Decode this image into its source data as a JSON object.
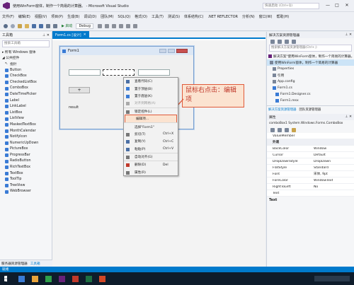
{
  "window": {
    "title": "使用WinForm窗体，制作一个简易的计算器。 - Microsoft Visual Studio",
    "quick_launch": "快速启动 (Ctrl+Q)"
  },
  "menu": [
    "文件(F)",
    "编辑(E)",
    "视图(V)",
    "项目(P)",
    "生成(B)",
    "调试(D)",
    "团队(M)",
    "SQL(Q)",
    "格式(O)",
    "工具(T)",
    "测试(S)",
    "体系结构(C)",
    ".NET REFLECTOR",
    "分析(N)",
    "窗口(W)",
    "帮助(H)"
  ],
  "toolbar": {
    "start_label": "▶ 启动",
    "config": "Debug"
  },
  "toolbox": {
    "title": "工具箱",
    "search_placeholder": "搜索工具箱",
    "group_all": "▸ 所有 Windows 窗体",
    "group_common": "◢ 公共控件",
    "items": [
      "指针",
      "Button",
      "CheckBox",
      "CheckedListBox",
      "ComboBox",
      "DateTimePicker",
      "Label",
      "LinkLabel",
      "ListBox",
      "ListView",
      "MaskedTextBox",
      "MonthCalendar",
      "NotifyIcon",
      "NumericUpDown",
      "PictureBox",
      "ProgressBar",
      "RadioButton",
      "RichTextBox",
      "TextBox",
      "ToolTip",
      "TreeView",
      "WebBrowser"
    ],
    "bottom_tabs": [
      "服务器资源管理器",
      "工具箱"
    ]
  },
  "editor": {
    "tabs": [
      "Form1.cs [设计]"
    ],
    "form_title": "Form1",
    "button_text": "+",
    "label_text": "result"
  },
  "annotation": "鼠标右点击：编辑项",
  "context_menu": [
    {
      "label": "查看代码(C)",
      "shortcut": ""
    },
    {
      "label": "置于顶层(B)",
      "shortcut": ""
    },
    {
      "label": "置于底层(K)",
      "shortcut": ""
    },
    {
      "label": "对齐到网格(A)",
      "shortcut": ""
    },
    {
      "label": "锁定控件(L)",
      "shortcut": ""
    },
    {
      "label": "编辑项...",
      "shortcut": ""
    },
    {
      "label": "选择\"Form1\"",
      "shortcut": ""
    },
    {
      "label": "剪切(T)",
      "shortcut": "Ctrl+X"
    },
    {
      "label": "复制(Y)",
      "shortcut": "Ctrl+C"
    },
    {
      "label": "粘贴(P)",
      "shortcut": "Ctrl+V"
    },
    {
      "label": "自动对齐(G)",
      "shortcut": ""
    },
    {
      "label": "删除(D)",
      "shortcut": "Del"
    },
    {
      "label": "属性(R)",
      "shortcut": ""
    }
  ],
  "solution_explorer": {
    "title": "解决方案资源管理器",
    "search_placeholder": "搜索解决方案资源管理器(Ctrl+;)",
    "items": [
      "解决方案\"使用WinForm窗体，制作一个简易的计算器。\"",
      "使用WinForm窗体，制作一个简易的计算器",
      "Properties",
      "引用",
      "App.config",
      "Form1.cs",
      "Form1.Designer.cs",
      "Form1.resx"
    ],
    "bottom_tabs": [
      "解决方案资源管理器",
      "团队资源管理器"
    ]
  },
  "properties": {
    "title": "属性",
    "object": "comboBox1 System.Windows.Forms.ComboBox",
    "rows": [
      {
        "name": "ValueMember",
        "value": ""
      },
      {
        "name": "外观",
        "value": ""
      },
      {
        "name": "BackColor",
        "value": "Window"
      },
      {
        "name": "Cursor",
        "value": "Default"
      },
      {
        "name": "DropDownStyle",
        "value": "DropDown"
      },
      {
        "name": "FlatStyle",
        "value": "Standard"
      },
      {
        "name": "Font",
        "value": "宋体, 9pt"
      },
      {
        "name": "ForeColor",
        "value": "WindowText"
      },
      {
        "name": "RightToLeft",
        "value": "No"
      },
      {
        "name": "Text",
        "value": ""
      }
    ],
    "desc_title": "Text"
  },
  "status": {
    "text": "就绪"
  },
  "colors": {
    "accent": "#007acc",
    "annotation_border": "#e05a3a",
    "annotation_bg": "#fbe3d0",
    "annotation_text": "#c0392b"
  }
}
